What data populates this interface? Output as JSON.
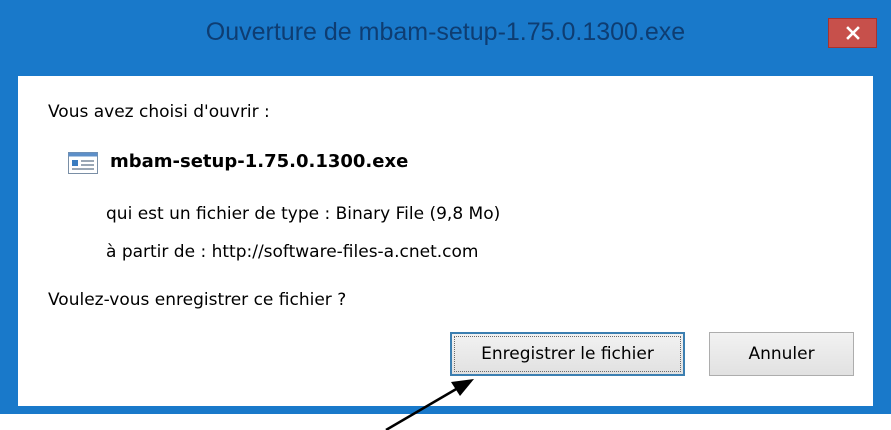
{
  "window": {
    "title": "Ouverture de mbam-setup-1.75.0.1300.exe",
    "close_icon": "close-icon"
  },
  "dialog": {
    "intro": "Vous avez choisi d'ouvrir :",
    "file_icon": "file-icon",
    "filename": "mbam-setup-1.75.0.1300.exe",
    "type_row": "qui est un fichier de type : Binary File (9,8 Mo)",
    "from_row": "à partir de : http://software-files-a.cnet.com",
    "question": "Voulez-vous enregistrer ce fichier ?",
    "save_label": "Enregistrer le fichier",
    "cancel_label": "Annuler"
  },
  "colors": {
    "frame": "#1979ca",
    "close": "#c7504b",
    "title_text": "#0e3d72"
  }
}
